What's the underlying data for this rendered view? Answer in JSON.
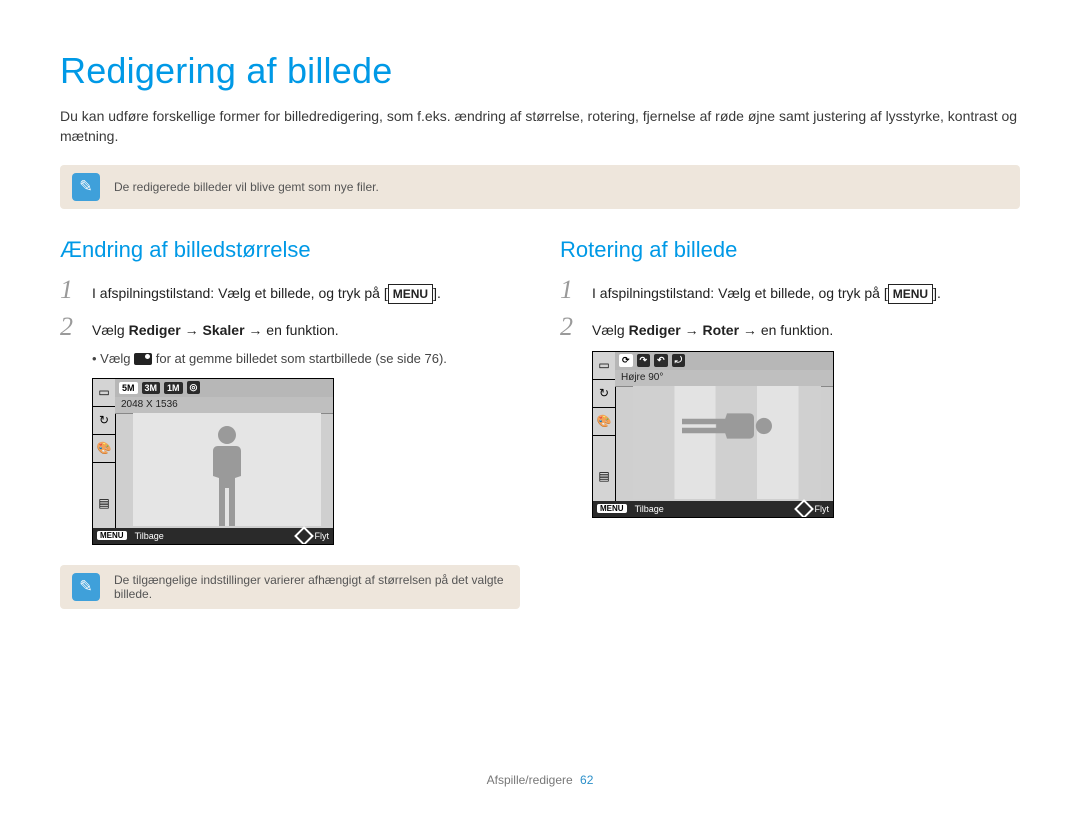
{
  "title": "Redigering af billede",
  "intro": "Du kan udføre forskellige former for billedredigering, som f.eks. ændring af størrelse, rotering, fjernelse af røde øjne samt justering af lysstyrke, kontrast og mætning.",
  "top_note": "De redigerede billeder vil blive gemt som nye filer.",
  "left": {
    "heading": "Ændring af billedstørrelse",
    "step1_pre": "I afspilningstilstand: Vælg et billede, og tryk på [",
    "step1_menu": "MENU",
    "step1_post": "].",
    "step2_pre": "Vælg ",
    "step2_b1": "Rediger",
    "step2_arrow": " → ",
    "step2_b2": "Skaler",
    "step2_post": " → en funktion.",
    "bullet_pre": "• Vælg ",
    "bullet_post": " for at gemme billedet som startbillede (se side 76).",
    "ui": {
      "topbar": [
        "5M",
        "3M",
        "1M"
      ],
      "label": "2048 X 1536",
      "back_badge": "MENU",
      "back": "Tilbage",
      "move": "Flyt"
    },
    "note": "De tilgængelige indstillinger varierer afhængigt af størrelsen på det valgte billede."
  },
  "right": {
    "heading": "Rotering af billede",
    "step1_pre": "I afspilningstilstand: Vælg et billede, og tryk på [",
    "step1_menu": "MENU",
    "step1_post": "].",
    "step2_pre": "Vælg ",
    "step2_b1": "Rediger",
    "step2_arrow": " → ",
    "step2_b2": "Roter",
    "step2_post": " → en funktion.",
    "ui": {
      "label": "Højre 90°",
      "back_badge": "MENU",
      "back": "Tilbage",
      "move": "Flyt"
    }
  },
  "footer": {
    "section": "Afspille/redigere",
    "page": "62"
  }
}
